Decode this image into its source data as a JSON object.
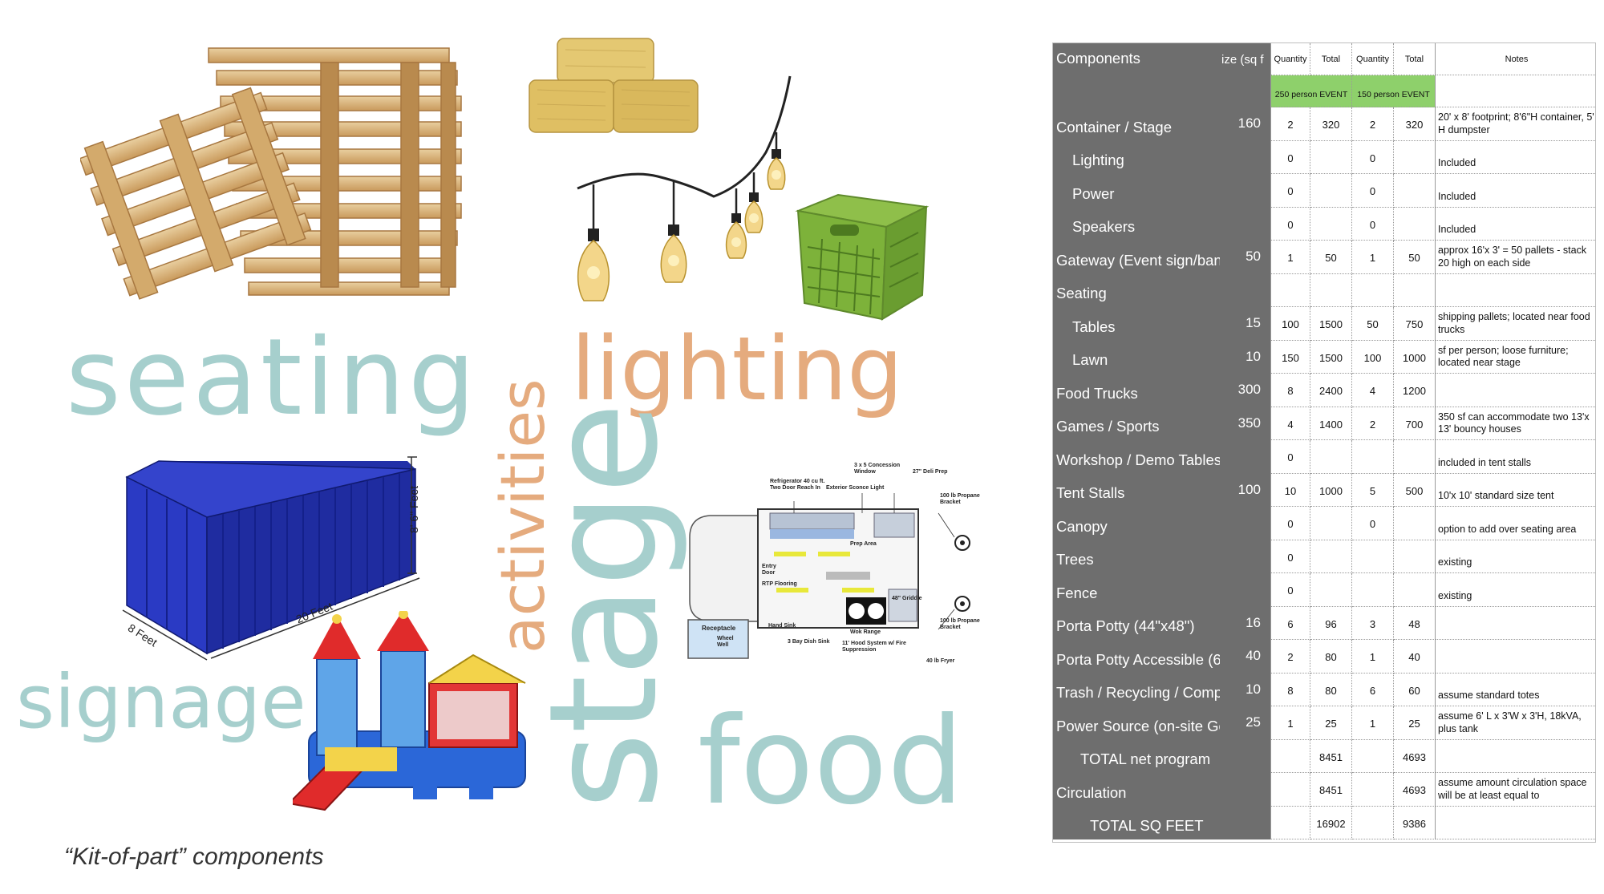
{
  "caption": "“Kit-of-part” components",
  "words": {
    "seating": "seating",
    "activities": "activities",
    "lighting": "lighting",
    "stage": "stage",
    "signage": "signage",
    "food": "food"
  },
  "colors": {
    "teal": "#a6cfcd",
    "tan": "#e5ab7e",
    "header_gray": "#6e6e6e",
    "event_green": "#8ed06b",
    "container_blue": "#2431b3"
  },
  "container_labels": {
    "height": "8' 6\" Feet",
    "length": "20 Feet",
    "width": "8 Feet"
  },
  "truck_labels": {
    "concession_window": "3 x 5 Concession Window",
    "deli_prep": "27\" Deli Prep",
    "refrigerator": "Refrigerator 40 cu ft. Two Door Reach In",
    "exterior_light": "Exterior Sconce Light",
    "propane_top": "100 lb Propane Bracket",
    "prep_area": "Prep Area",
    "entry_door": "Entry Door",
    "flooring": "RTP Flooring",
    "griddle": "48\" Griddle",
    "wok_range": "Wok Range",
    "hand_sink": "Hand Sink",
    "dish_sink": "3 Bay Dish Sink",
    "hood_system": "11' Hood System w/ Fire Suppression",
    "propane_bottom": "100 lb Propane Bracket",
    "fryer": "40 lb Fryer",
    "receptacle": "Receptacle",
    "wheel_well": "Wheel Well"
  },
  "table": {
    "headers": {
      "components": "Components",
      "size": "ize (sq f",
      "quantity1": "Quantity",
      "total1": "Total",
      "quantity2": "Quantity",
      "total2": "Total",
      "notes": "Notes"
    },
    "events": {
      "event1": "250 person EVENT",
      "event2": "150 person EVENT"
    },
    "rows": [
      {
        "name": "Container / Stage",
        "indent": 0,
        "size": "160",
        "q1": "2",
        "t1": "320",
        "q2": "2",
        "t2": "320",
        "note": "20' x 8' footprint; 8'6\"H container, 5' H dumpster"
      },
      {
        "name": "Lighting",
        "indent": 1,
        "size": "",
        "q1": "0",
        "t1": "",
        "q2": "0",
        "t2": "",
        "note": "Included"
      },
      {
        "name": "Power",
        "indent": 1,
        "size": "",
        "q1": "0",
        "t1": "",
        "q2": "0",
        "t2": "",
        "note": "Included"
      },
      {
        "name": "Speakers",
        "indent": 1,
        "size": "",
        "q1": "0",
        "t1": "",
        "q2": "0",
        "t2": "",
        "note": "Included"
      },
      {
        "name": "Gateway (Event sign/bann",
        "indent": 0,
        "size": "50",
        "q1": "1",
        "t1": "50",
        "q2": "1",
        "t2": "50",
        "note": "approx 16'x 3' = 50 pallets - stack 20 high on each side"
      },
      {
        "name": "Seating",
        "indent": 0,
        "size": "",
        "q1": "",
        "t1": "",
        "q2": "",
        "t2": "",
        "note": ""
      },
      {
        "name": "Tables",
        "indent": 1,
        "size": "15",
        "q1": "100",
        "t1": "1500",
        "q2": "50",
        "t2": "750",
        "note": "shipping pallets; located near food trucks"
      },
      {
        "name": "Lawn",
        "indent": 1,
        "size": "10",
        "q1": "150",
        "t1": "1500",
        "q2": "100",
        "t2": "1000",
        "note": "sf per person; loose furniture; located near stage"
      },
      {
        "name": "Food Trucks",
        "indent": 0,
        "size": "300",
        "q1": "8",
        "t1": "2400",
        "q2": "4",
        "t2": "1200",
        "note": ""
      },
      {
        "name": "Games / Sports",
        "indent": 0,
        "size": "350",
        "q1": "4",
        "t1": "1400",
        "q2": "2",
        "t2": "700",
        "note": "350 sf can accommodate two 13'x 13' bouncy houses"
      },
      {
        "name": "Workshop / Demo Tables",
        "indent": 0,
        "size": "",
        "q1": "0",
        "t1": "",
        "q2": "",
        "t2": "",
        "note": "included in tent stalls"
      },
      {
        "name": "Tent Stalls",
        "indent": 0,
        "size": "100",
        "q1": "10",
        "t1": "1000",
        "q2": "5",
        "t2": "500",
        "note": "10'x 10' standard size tent"
      },
      {
        "name": "Canopy",
        "indent": 0,
        "size": "",
        "q1": "0",
        "t1": "",
        "q2": "0",
        "t2": "",
        "note": "option to add over seating area"
      },
      {
        "name": "Trees",
        "indent": 0,
        "size": "",
        "q1": "0",
        "t1": "",
        "q2": "",
        "t2": "",
        "note": "existing"
      },
      {
        "name": "Fence",
        "indent": 0,
        "size": "",
        "q1": "0",
        "t1": "",
        "q2": "",
        "t2": "",
        "note": "existing"
      },
      {
        "name": "Porta Potty (44\"x48\")",
        "indent": 0,
        "size": "16",
        "q1": "6",
        "t1": "96",
        "q2": "3",
        "t2": "48",
        "note": ""
      },
      {
        "name": "Porta Potty Accessible (6:",
        "indent": 0,
        "size": "40",
        "q1": "2",
        "t1": "80",
        "q2": "1",
        "t2": "40",
        "note": ""
      },
      {
        "name": "Trash / Recycling / Comp",
        "indent": 0,
        "size": "10",
        "q1": "8",
        "t1": "80",
        "q2": "6",
        "t2": "60",
        "note": "assume standard totes"
      },
      {
        "name": "Power Source (on-site Ge",
        "indent": 0,
        "size": "25",
        "q1": "1",
        "t1": "25",
        "q2": "1",
        "t2": "25",
        "note": "assume 6' L x 3'W x 3'H, 18kVA, plus tank"
      },
      {
        "name": "TOTAL net program",
        "indent": 2,
        "size": "",
        "q1": "",
        "t1": "8451",
        "q2": "",
        "t2": "4693",
        "note": ""
      },
      {
        "name": "Circulation",
        "indent": 0,
        "size": "",
        "q1": "",
        "t1": "8451",
        "q2": "",
        "t2": "4693",
        "note": "assume amount circulation space will be at least equal to"
      },
      {
        "name": "TOTAL SQ FEET",
        "indent": 3,
        "size": "",
        "q1": "",
        "t1": "16902",
        "q2": "",
        "t2": "9386",
        "note": ""
      }
    ]
  }
}
